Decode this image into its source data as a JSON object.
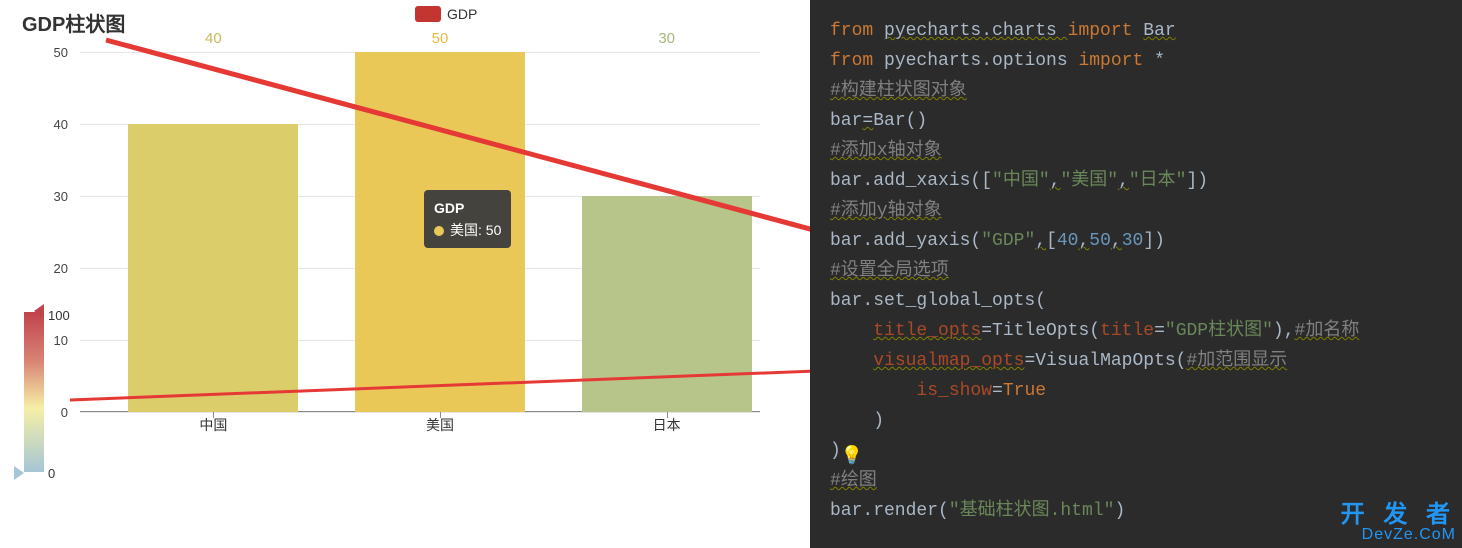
{
  "chart_data": {
    "type": "bar",
    "title": "GDP柱状图",
    "legend": "GDP",
    "categories": [
      "中国",
      "美国",
      "日本"
    ],
    "values": [
      40,
      50,
      30
    ],
    "ylim": [
      0,
      50
    ],
    "yticks": [
      0,
      10,
      20,
      30,
      40,
      50
    ],
    "bar_colors": [
      "#dccd6b",
      "#eac858",
      "#b7c48a"
    ],
    "label_colors": [
      "#c9b95a",
      "#e4bb3f",
      "#a6b77c"
    ],
    "visualmap": {
      "min": 0,
      "max": 100
    },
    "tooltip": {
      "series": "GDP",
      "name": "美国",
      "value": 50
    }
  },
  "code": {
    "lines": [
      {
        "segs": [
          {
            "t": "from ",
            "c": "kw"
          },
          {
            "t": "pyecharts.charts ",
            "c": "warn"
          },
          {
            "t": "import ",
            "c": "kw"
          },
          {
            "t": "Bar",
            "c": "warn"
          }
        ]
      },
      {
        "segs": [
          {
            "t": "from ",
            "c": "kw"
          },
          {
            "t": "pyecharts.options ",
            "c": "fn"
          },
          {
            "t": "import ",
            "c": "kw"
          },
          {
            "t": "*",
            "c": "fn"
          }
        ]
      },
      {
        "segs": [
          {
            "t": "#构建柱状图对象",
            "c": "cmt warn"
          }
        ]
      },
      {
        "segs": [
          {
            "t": "bar",
            "c": "fn"
          },
          {
            "t": "=",
            "c": "warn"
          },
          {
            "t": "Bar()",
            "c": "fn"
          }
        ]
      },
      {
        "segs": [
          {
            "t": "#添加x轴对象",
            "c": "cmt warn"
          }
        ]
      },
      {
        "segs": [
          {
            "t": "bar.add_xaxis([",
            "c": "fn"
          },
          {
            "t": "\"中国\"",
            "c": "str"
          },
          {
            "t": ",",
            "c": "warn"
          },
          {
            "t": "\"美国\"",
            "c": "str"
          },
          {
            "t": ",",
            "c": "warn"
          },
          {
            "t": "\"日本\"",
            "c": "str"
          },
          {
            "t": "])",
            "c": "fn"
          }
        ]
      },
      {
        "segs": [
          {
            "t": "#添加y轴对象",
            "c": "cmt warn"
          }
        ]
      },
      {
        "segs": [
          {
            "t": "bar.add_yaxis(",
            "c": "fn"
          },
          {
            "t": "\"GDP\"",
            "c": "str"
          },
          {
            "t": ",",
            "c": "warn"
          },
          {
            "t": "[",
            "c": "fn"
          },
          {
            "t": "40",
            "c": "num"
          },
          {
            "t": ",",
            "c": "warn"
          },
          {
            "t": "50",
            "c": "num"
          },
          {
            "t": ",",
            "c": "warn"
          },
          {
            "t": "30",
            "c": "num"
          },
          {
            "t": "])",
            "c": "fn"
          }
        ]
      },
      {
        "segs": [
          {
            "t": "#设置全局选项",
            "c": "cmt warn"
          }
        ]
      },
      {
        "segs": [
          {
            "t": "bar.set_global_opts(",
            "c": "fn"
          }
        ]
      },
      {
        "segs": [
          {
            "t": "    ",
            "c": "fn"
          },
          {
            "t": "title_opts",
            "c": "param warn"
          },
          {
            "t": "=TitleOpts(",
            "c": "fn"
          },
          {
            "t": "title",
            "c": "param"
          },
          {
            "t": "=",
            "c": "fn"
          },
          {
            "t": "\"GDP柱状图\"",
            "c": "str"
          },
          {
            "t": "),",
            "c": "fn"
          },
          {
            "t": "#加名称",
            "c": "cmt warn"
          }
        ]
      },
      {
        "segs": [
          {
            "t": "    ",
            "c": "fn"
          },
          {
            "t": "visualmap_opts",
            "c": "param warn"
          },
          {
            "t": "=VisualMapOpts(",
            "c": "fn"
          },
          {
            "t": "#加范围显示",
            "c": "cmt warn"
          }
        ]
      },
      {
        "segs": [
          {
            "t": "        ",
            "c": "fn"
          },
          {
            "t": "is_show",
            "c": "param"
          },
          {
            "t": "=",
            "c": "fn"
          },
          {
            "t": "True",
            "c": "kw"
          }
        ]
      },
      {
        "segs": [
          {
            "t": "    )",
            "c": "fn"
          }
        ]
      },
      {
        "segs": [
          {
            "t": ")",
            "c": "fn"
          },
          {
            "t": "💡",
            "c": "bulb"
          }
        ]
      },
      {
        "segs": [
          {
            "t": "#绘图",
            "c": "cmt warn"
          }
        ]
      },
      {
        "segs": [
          {
            "t": "bar.render(",
            "c": "fn"
          },
          {
            "t": "\"基础柱状图.html\"",
            "c": "str"
          },
          {
            "t": ")",
            "c": "fn"
          }
        ]
      }
    ]
  },
  "watermark": {
    "line1": "开 发 者",
    "line2": "DevZe.CoM"
  }
}
